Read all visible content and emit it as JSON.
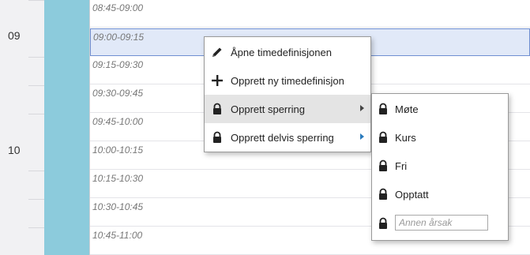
{
  "calendar": {
    "hours": [
      "09",
      "10"
    ],
    "slots": [
      {
        "label": "08:45-09:00",
        "selected": false
      },
      {
        "label": "09:00-09:15",
        "selected": true
      },
      {
        "label": "09:15-09:30",
        "selected": false
      },
      {
        "label": "09:30-09:45",
        "selected": false
      },
      {
        "label": "09:45-10:00",
        "selected": false
      },
      {
        "label": "10:00-10:15",
        "selected": false
      },
      {
        "label": "10:15-10:30",
        "selected": false
      },
      {
        "label": "10:30-10:45",
        "selected": false
      },
      {
        "label": "10:45-11:00",
        "selected": false
      }
    ],
    "colors": {
      "resource_bar": "#8ccbdc",
      "selected_slot": "#e1e9f8"
    }
  },
  "context_menu": {
    "items": [
      {
        "icon": "pencil-icon",
        "label": "Åpne timedefinisjonen"
      },
      {
        "icon": "plus-icon",
        "label": "Opprett ny timedefinisjon"
      },
      {
        "icon": "lock-icon",
        "label": "Opprett sperring",
        "submenu": true,
        "highlighted": true
      },
      {
        "icon": "lock-icon",
        "label": "Opprett delvis sperring",
        "submenu": true
      }
    ]
  },
  "submenu": {
    "items": [
      {
        "icon": "lock-icon",
        "label": "Møte"
      },
      {
        "icon": "lock-icon",
        "label": "Kurs"
      },
      {
        "icon": "lock-icon",
        "label": "Fri"
      },
      {
        "icon": "lock-icon",
        "label": "Opptatt"
      }
    ],
    "other_reason": {
      "icon": "lock-icon",
      "placeholder": "Annen årsak",
      "value": ""
    }
  }
}
